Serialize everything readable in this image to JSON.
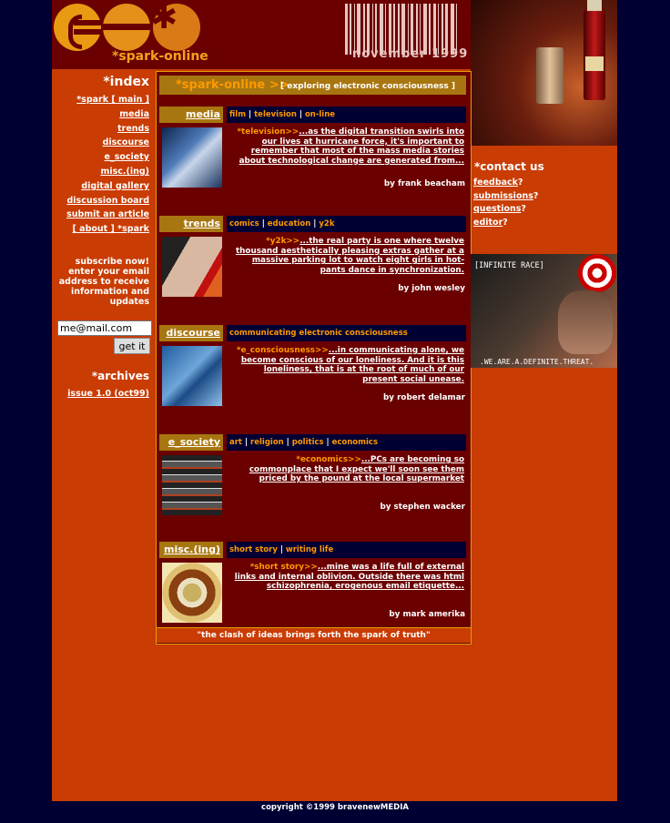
{
  "header": {
    "logo_text": "*spark-online",
    "month": "november 1999"
  },
  "sidebar": {
    "index_title": "*index",
    "links": [
      "*spark [ main ]",
      "media",
      "trends",
      "discourse",
      "e_society",
      "misc.(ing)",
      "digital gallery",
      "discussion board",
      "submit an article",
      "[ about ] *spark"
    ],
    "subscribe_lines": [
      "subscribe now!",
      "enter your email",
      "address to receive",
      "information and",
      "updates"
    ],
    "email_value": "me@mail.com",
    "button_label": "get it",
    "archives_title": "*archives",
    "archives_link": "issue 1.0 (oct99)"
  },
  "main": {
    "title_site": "*spark-online >>",
    "title_tag": "[ exploring electronic consciousness ]",
    "sections": [
      {
        "name": "media",
        "subcats": [
          "film",
          "television",
          "on-line"
        ],
        "keyword": "*television>>",
        "text": "...as the digital transition swirls into our lives at hurricane force, it's important to remember that most of the mass media stories about technological change are generated from...",
        "byline": "by frank beacham"
      },
      {
        "name": "trends",
        "subcats": [
          "comics",
          "education",
          "y2k"
        ],
        "keyword": "*y2k>>",
        "text": "...the real party is one where twelve thousand aesthetically pleasing extras gather at a massive parking lot to watch eight girls in hot-pants dance in synchronization.",
        "byline": "by john wesley"
      },
      {
        "name": "discourse",
        "subcats": [
          "communicating electronic consciousness"
        ],
        "keyword": "*e_consciousness>>",
        "text": "...in communicating alone, we become conscious of our loneliness. And it is this loneliness, that is at the root of much of our present social unease.",
        "byline": "by robert delamar"
      },
      {
        "name": "e_society",
        "subcats": [
          "art",
          "religion",
          "politics",
          "economics"
        ],
        "keyword": "*economics>>",
        "text": "...PCs are becoming so commonplace that I expect we'll soon see them priced by the pound at the local supermarket",
        "byline": "by stephen wacker"
      },
      {
        "name": "misc.(ing)",
        "subcats": [
          "short story",
          "writing life"
        ],
        "keyword": "*short story>>",
        "text": "...mine was a life full of external links and internal oblivion. Outside there was html schizophrenia, erogenous email etiquette...",
        "byline": "by mark amerika"
      }
    ],
    "quote": "\"the clash of ideas brings forth the spark of truth\""
  },
  "right": {
    "contact_title": "*contact us",
    "links": [
      "feedback",
      "submissions",
      "questions",
      "editor"
    ],
    "ad_top": "[INFINITE RACE]",
    "ad_bottom": ".WE.ARE.A.DEFINITE.THREAT."
  },
  "footer": "copyright ©1999 bravenewMEDIA",
  "colors": {
    "background": "#000033",
    "page": "#c93c04",
    "panel": "#6b0000",
    "accent": "#ff9a00",
    "gold": "#a87610"
  }
}
